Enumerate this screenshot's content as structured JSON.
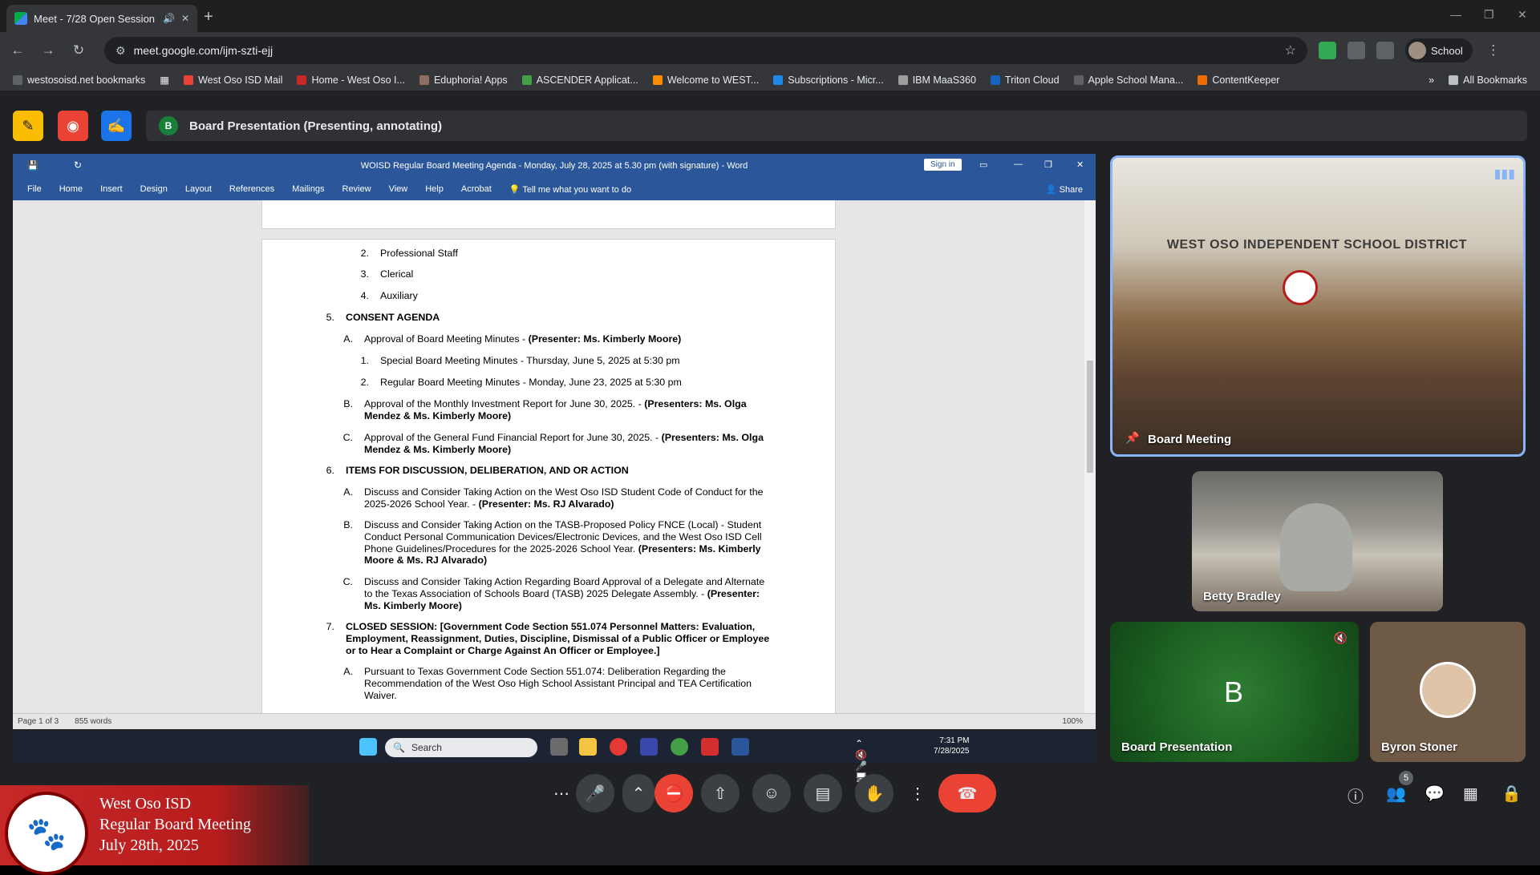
{
  "browser": {
    "tab_title": "Meet - 7/28 Open Session",
    "url": "meet.google.com/ijm-szti-ejj",
    "profile": "School",
    "bookmarks": [
      "westosoisd.net bookmarks",
      "West Oso ISD Mail",
      "Home - West Oso I...",
      "Eduphoria! Apps",
      "ASCENDER Applicat...",
      "Welcome to WEST...",
      "Subscriptions - Micr...",
      "IBM MaaS360",
      "Triton Cloud",
      "Apple School Mana...",
      "ContentKeeper"
    ],
    "all_bookmarks": "All Bookmarks"
  },
  "presenting": {
    "avatar_letter": "B",
    "label": "Board Presentation (Presenting, annotating)"
  },
  "word": {
    "title": "WOISD Regular Board Meeting Agenda - Monday, July 28, 2025 at 5.30 pm (with signature)  -  Word",
    "sign_in": "Sign in",
    "menu": [
      "File",
      "Home",
      "Insert",
      "Design",
      "Layout",
      "References",
      "Mailings",
      "Review",
      "View",
      "Help",
      "Acrobat"
    ],
    "tell_me": "Tell me what you want to do",
    "share": "Share",
    "status_page": "Page 1 of 3",
    "status_words": "855 words",
    "zoom": "100%",
    "doc": {
      "l1_num": "2.",
      "l1": "Professional Staff",
      "l2_num": "3.",
      "l2": "Clerical",
      "l3_num": "4.",
      "l3": "Auxiliary",
      "s5_num": "5.",
      "s5": "CONSENT AGENDA",
      "a5_num": "A.",
      "a5": "Approval of Board Meeting Minutes - ",
      "a5b": "(Presenter: Ms. Kimberly Moore)",
      "a5_1_num": "1.",
      "a5_1": "Special Board Meeting Minutes - Thursday, June 5, 2025 at 5:30 pm",
      "a5_2_num": "2.",
      "a5_2": "Regular Board Meeting Minutes - Monday, June 23, 2025 at 5:30 pm",
      "b5_num": "B.",
      "b5": "Approval of the Monthly Investment Report for June 30, 2025. - ",
      "b5b": "(Presenters: Ms. Olga",
      "b5c": "Mendez & Ms. Kimberly Moore)",
      "c5_num": "C.",
      "c5": "Approval of the General Fund Financial Report for June 30, 2025. - ",
      "c5b": "(Presenters: Ms. Olga",
      "c5c": "Mendez & Ms. Kimberly Moore)",
      "s6_num": "6.",
      "s6": "ITEMS FOR DISCUSSION, DELIBERATION, AND OR ACTION",
      "a6_num": "A.",
      "a6": "Discuss and Consider Taking Action on the West Oso ISD Student Code of Conduct for the",
      "a6l2": "2025-2026 School Year. - ",
      "a6b": "(Presenter: Ms. RJ Alvarado)",
      "b6_num": "B.",
      "b6": "Discuss and Consider Taking Action on the TASB-Proposed Policy FNCE (Local) -  Student",
      "b6l2": "Conduct Personal Communication Devices/Electronic Devices, and the West Oso ISD Cell",
      "b6l3": "Phone Guidelines/Procedures for the 2025-2026 School Year. ",
      "b6b": "(Presenters: Ms. Kimberly",
      "b6l4": "Moore & Ms. RJ  Alvarado)",
      "c6_num": "C.",
      "c6": "Discuss and Consider Taking Action Regarding Board Approval of a Delegate and Alternate",
      "c6l2": "to the Texas Association of Schools Board (TASB) 2025 Delegate Assembly. - ",
      "c6b": "(Presenter:",
      "c6l3": "Ms. Kimberly Moore)",
      "s7_num": "7.",
      "s7": "CLOSED SESSION: [Government Code Section 551.074 Personnel Matters: Evaluation,",
      "s7l2": "Employment, Reassignment, Duties, Discipline, Dismissal of a Public Officer or Employee",
      "s7l3": "or to Hear a Complaint or Charge Against An Officer or Employee.]",
      "a7_num": "A.",
      "a7": "Pursuant to Texas Government Code Section 551.074: Deliberation Regarding the",
      "a7l2": "Recommendation of the West Oso High School Assistant Principal and TEA Certification",
      "a7l3": "Waiver."
    }
  },
  "windows_taskbar": {
    "search": "Search",
    "time": "7:31 PM",
    "date": "7/28/2025"
  },
  "tiles": {
    "main": "Board Meeting",
    "main_sign": "WEST OSO INDEPENDENT SCHOOL DISTRICT",
    "betty": "Betty Bradley",
    "board_presentation": "Board Presentation",
    "board_presentation_letter": "B",
    "byron": "Byron Stoner"
  },
  "overlay": {
    "line1": "West Oso ISD",
    "line2": "Regular Board Meeting",
    "line3": "July 28th, 2025"
  },
  "controls": {
    "participants_count": "5"
  }
}
